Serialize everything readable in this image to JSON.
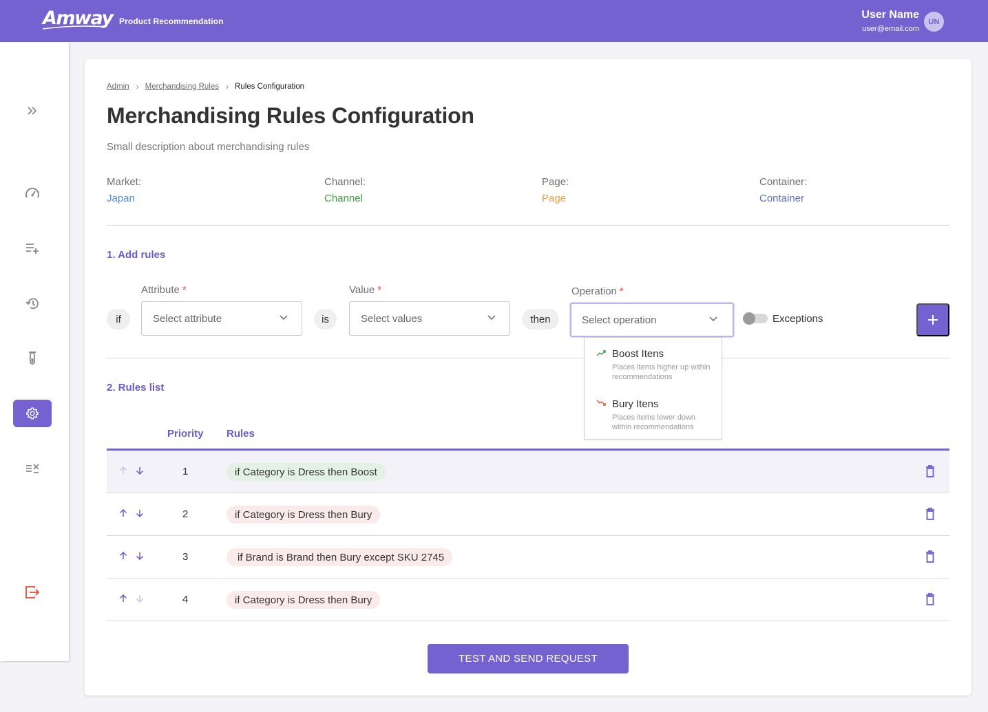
{
  "header": {
    "logo": "Amway",
    "product": "Product Recommendation",
    "user_name": "User Name",
    "user_email": "user@email.com",
    "avatar_initials": "UN"
  },
  "sidebar": {
    "items": [
      {
        "icon": "expand-icon"
      },
      {
        "icon": "speedometer-icon"
      },
      {
        "icon": "playlist-add-icon"
      },
      {
        "icon": "history-icon"
      },
      {
        "icon": "test-tube-icon"
      },
      {
        "icon": "gear-icon",
        "active": true
      },
      {
        "icon": "list-check-icon"
      },
      {
        "icon": "logout-icon"
      }
    ]
  },
  "breadcrumb": [
    {
      "label": "Admin"
    },
    {
      "label": "Merchandising Rules"
    },
    {
      "label": "Rules Configuration"
    }
  ],
  "page": {
    "title": "Merchandising Rules Configuration",
    "description": "Small description about merchandising rules"
  },
  "meta": [
    {
      "label": "Market:",
      "value": "Japan",
      "color": "#4a90d9"
    },
    {
      "label": "Channel:",
      "value": "Channel",
      "color": "#3f9f3f"
    },
    {
      "label": "Page:",
      "value": "Page",
      "color": "#f0a040"
    },
    {
      "label": "Container:",
      "value": "Container",
      "color": "#5b6ec7"
    }
  ],
  "add_rules": {
    "title": "1. Add rules",
    "if_label": "if",
    "is_label": "is",
    "then_label": "then",
    "attribute": {
      "label": "Attribute",
      "required": "*",
      "placeholder": "Select attribute"
    },
    "value": {
      "label": "Value",
      "required": "*",
      "placeholder": "Select values"
    },
    "operation": {
      "label": "Operation",
      "required": "*",
      "placeholder": "Select operation"
    },
    "exceptions_label": "Exceptions",
    "exceptions_on": false,
    "add_button_icon": "plus-icon"
  },
  "operation_dropdown": {
    "options": [
      {
        "title": "Boost Itens",
        "description": "Places items higher up within recommendations",
        "icon": "trending-up-icon",
        "color": "#3f9f3f"
      },
      {
        "title": "Bury Itens",
        "description": "Places items lower down within recommendations",
        "icon": "trending-down-icon",
        "color": "#e74c3c"
      }
    ]
  },
  "rules_list": {
    "title": "2. Rules list",
    "columns": {
      "priority": "Priority",
      "rules": "Rules"
    },
    "rows": [
      {
        "priority": "1",
        "rule": "if Category is Dress then Boost",
        "type": "boost",
        "up_enabled": false,
        "down_enabled": true
      },
      {
        "priority": "2",
        "rule": "if Category is Dress then Bury",
        "type": "bury",
        "up_enabled": true,
        "down_enabled": true
      },
      {
        "priority": "3",
        "rule": "if Brand is Brand then Bury except SKU 2745",
        "type": "bury",
        "up_enabled": true,
        "down_enabled": true
      },
      {
        "priority": "4",
        "rule": "if Category is Dress then Bury",
        "type": "bury",
        "up_enabled": true,
        "down_enabled": false
      }
    ]
  },
  "actions": {
    "submit_label": "TEST AND SEND REQUEST"
  },
  "colors": {
    "primary": "#7462d0",
    "boost_bg": "#e3f1e3",
    "bury_bg": "#fbeaea"
  }
}
